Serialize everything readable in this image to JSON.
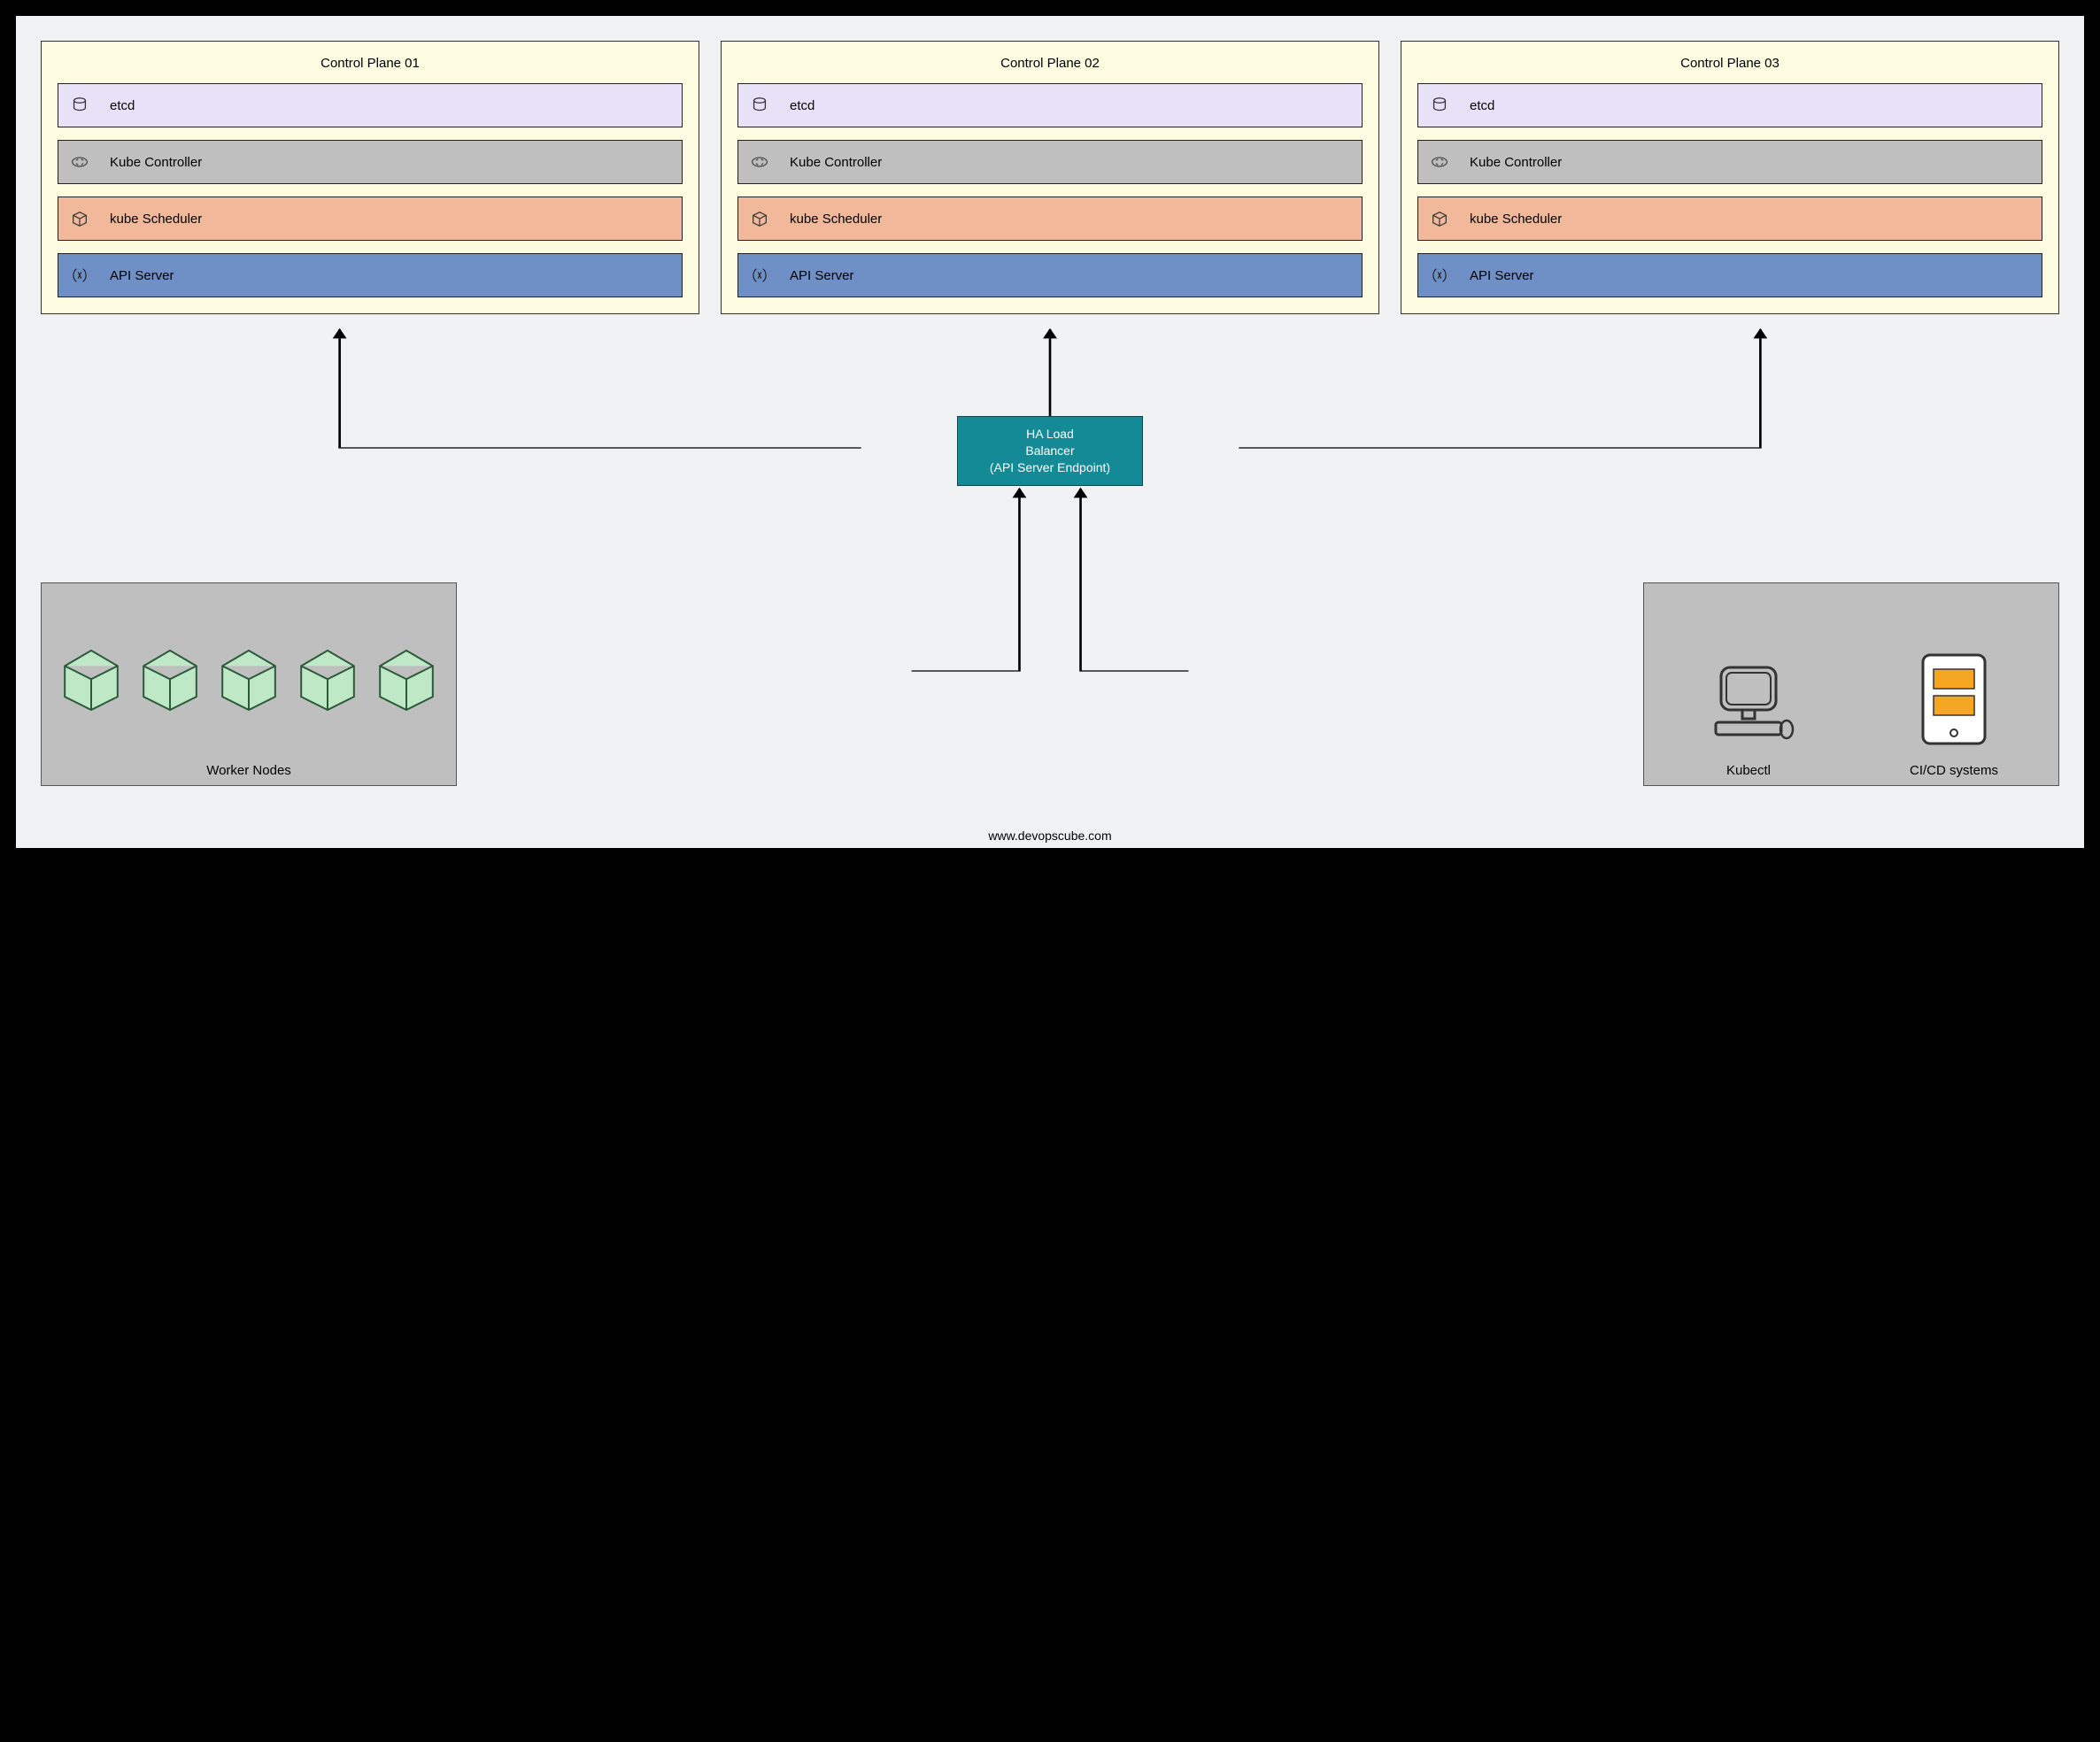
{
  "controlPlanes": [
    {
      "title": "Control Plane 01",
      "components": [
        {
          "label": "etcd"
        },
        {
          "label": "Kube Controller"
        },
        {
          "label": "kube Scheduler"
        },
        {
          "label": "API Server"
        }
      ]
    },
    {
      "title": "Control Plane 02",
      "components": [
        {
          "label": "etcd"
        },
        {
          "label": "Kube Controller"
        },
        {
          "label": "kube Scheduler"
        },
        {
          "label": "API Server"
        }
      ]
    },
    {
      "title": "Control Plane 03",
      "components": [
        {
          "label": "etcd"
        },
        {
          "label": "Kube Controller"
        },
        {
          "label": "kube Scheduler"
        },
        {
          "label": "API Server"
        }
      ]
    }
  ],
  "loadBalancer": {
    "line1": "HA Load",
    "line2": "Balancer",
    "line3": "(API Server Endpoint)"
  },
  "workerNodes": {
    "label": "Worker Nodes"
  },
  "clients": {
    "kubectl": "Kubectl",
    "cicd": "CI/CD systems"
  },
  "footer": "www.devopscube.com"
}
